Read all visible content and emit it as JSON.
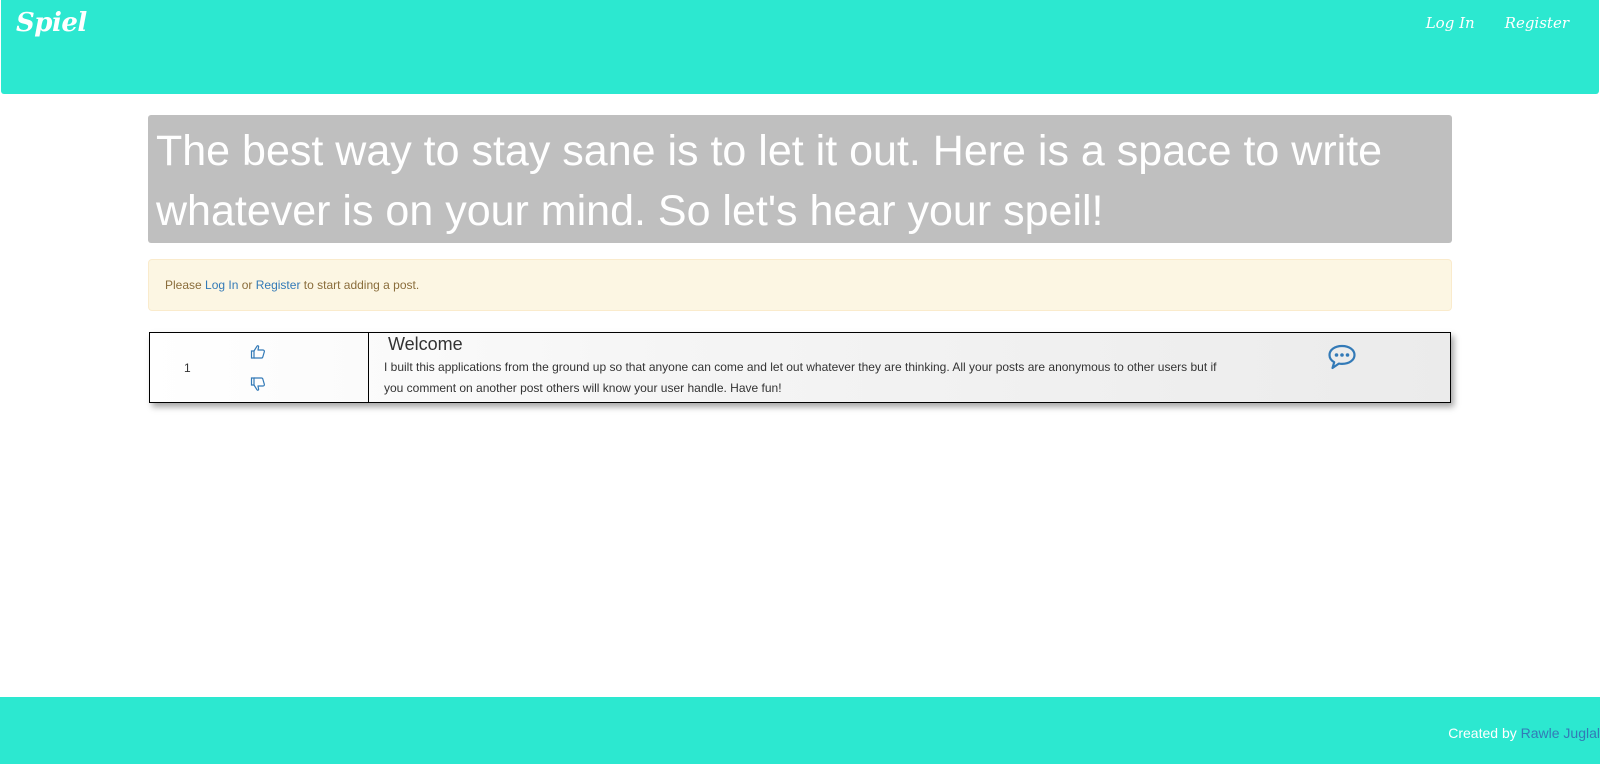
{
  "navbar": {
    "brand": "Spiel",
    "links": [
      "Log In",
      "Register"
    ],
    "color": "#2ce8d0"
  },
  "hero": {
    "text": "The best way to stay sane is to let it out. Here is a space to write whatever is on your mind. So let's hear your speil!",
    "background": "#bfbfbf"
  },
  "alert": {
    "prefix": "Please ",
    "login_link": "Log In",
    "middle": " or ",
    "register_link": "Register",
    "suffix": " to start adding a post."
  },
  "posts": [
    {
      "votes": "1",
      "upvote_icon": "thumbs-up-icon",
      "downvote_icon": "thumbs-down-icon",
      "title": "Welcome",
      "body": "I built this applications from the ground up so that anyone can come and let out whatever they are thinking. All your posts are anonymous to other users but if you comment on another post others will know your user handle. Have fun!",
      "comment_icon": "comment-bubble-icon"
    }
  ],
  "footer": {
    "prefix": "Created by ",
    "author": "Rawle Juglal"
  }
}
